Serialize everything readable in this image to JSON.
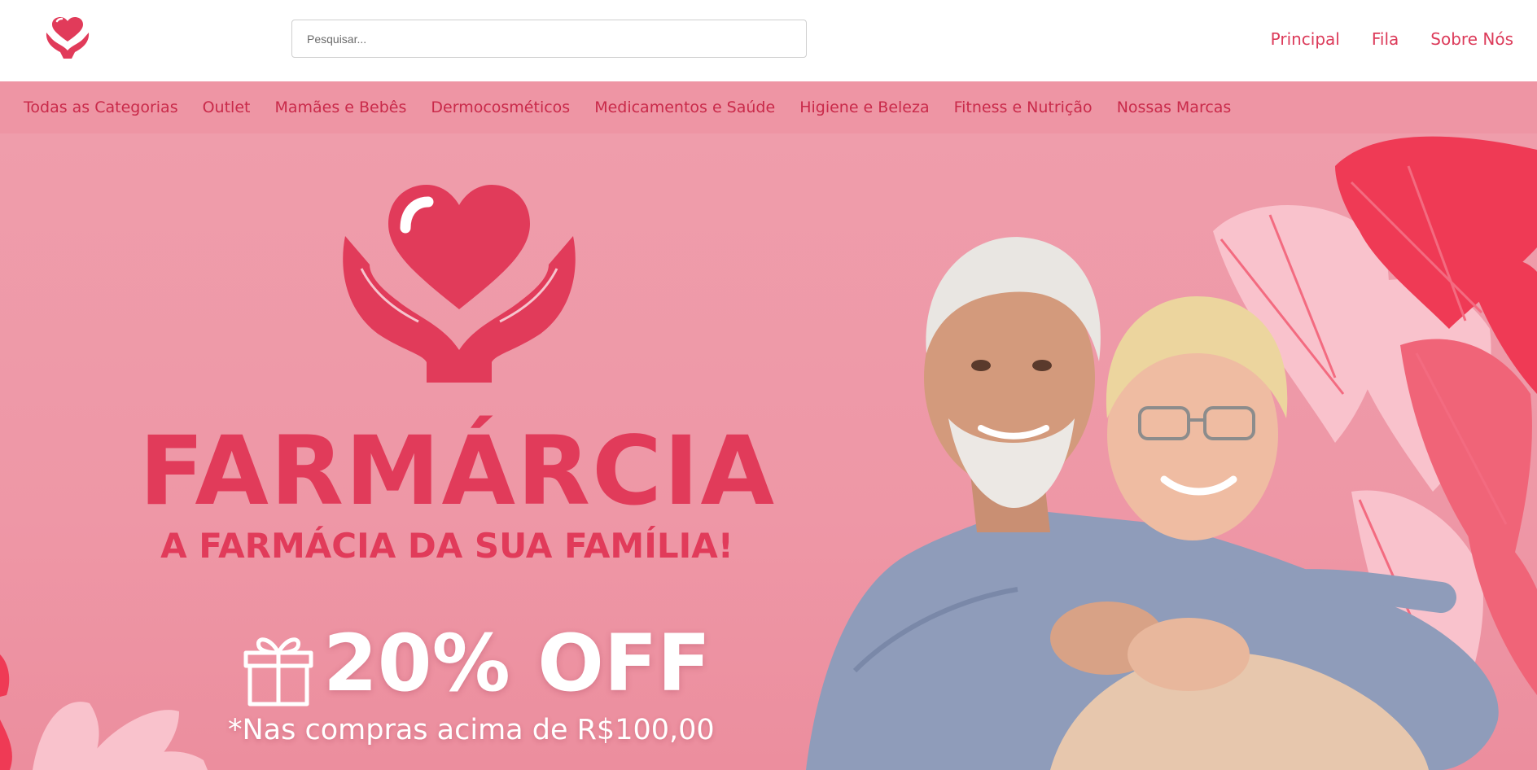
{
  "header": {
    "logo_icon": "heart-in-hands-icon",
    "search": {
      "placeholder": "Pesquisar...",
      "value": ""
    },
    "nav": [
      {
        "label": "Principal"
      },
      {
        "label": "Fila"
      },
      {
        "label": "Sobre Nós"
      }
    ]
  },
  "categories": [
    {
      "label": "Todas as Categorias"
    },
    {
      "label": "Outlet"
    },
    {
      "label": "Mamães e Bebês"
    },
    {
      "label": "Dermocosméticos"
    },
    {
      "label": "Medicamentos e Saúde"
    },
    {
      "label": "Higiene e Beleza"
    },
    {
      "label": "Fitness e Nutrição"
    },
    {
      "label": "Nossas Marcas"
    }
  ],
  "banner": {
    "brand": "FARMÁRCIA",
    "tagline": "A FARMÁCIA DA SUA FAMÍLIA!",
    "discount": "20% OFF",
    "condition": "*Nas compras acima de R$100,00",
    "gift_icon": "gift-icon",
    "photo": "elderly-couple-embracing-photo"
  },
  "colors": {
    "brand": "#e13b5a",
    "nav_text": "#dc3b5a",
    "category_bar": "#ee95a4",
    "category_text": "#c92a4a",
    "banner_bg": "#ef9dab",
    "leaf_dark": "#ef3a55",
    "leaf_light": "#f9c2cc"
  }
}
